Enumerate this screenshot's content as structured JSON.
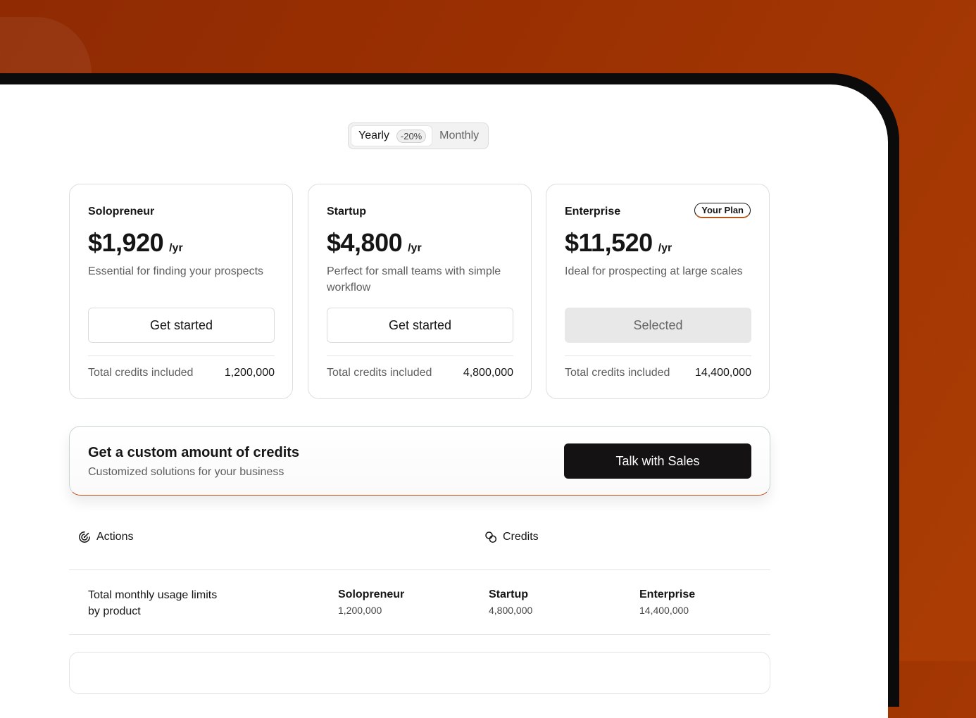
{
  "billing_toggle": {
    "yearly_label": "Yearly",
    "discount_badge": "-20%",
    "monthly_label": "Monthly",
    "selected": "Yearly"
  },
  "plans": [
    {
      "name": "Solopreneur",
      "price": "$1,920",
      "period": "/yr",
      "description": "Essential for finding your prospects",
      "button_label": "Get started",
      "credits_label": "Total credits included",
      "credits_value": "1,200,000"
    },
    {
      "name": "Startup",
      "price": "$4,800",
      "period": "/yr",
      "description": "Perfect for small teams with simple workflow",
      "button_label": "Get started",
      "credits_label": "Total credits included",
      "credits_value": "4,800,000"
    },
    {
      "name": "Enterprise",
      "badge": "Your Plan",
      "price": "$11,520",
      "period": "/yr",
      "description": "Ideal for prospecting at large scales",
      "button_label": "Selected",
      "credits_label": "Total credits included",
      "credits_value": "14,400,000"
    }
  ],
  "custom_banner": {
    "title": "Get a custom amount of credits",
    "subtitle": "Customized solutions for your business",
    "button_label": "Talk with Sales"
  },
  "usage_table": {
    "headers": {
      "actions": "Actions",
      "credits": "Credits"
    },
    "row_label": "Total monthly usage limits by product",
    "columns": [
      {
        "name": "Solopreneur",
        "value": "1,200,000"
      },
      {
        "name": "Startup",
        "value": "4,800,000"
      },
      {
        "name": "Enterprise",
        "value": "14,400,000"
      }
    ]
  },
  "colors": {
    "background_accent": "#9c3102",
    "plan_badge_accent": "#b5541d",
    "primary_button": "#141212"
  }
}
